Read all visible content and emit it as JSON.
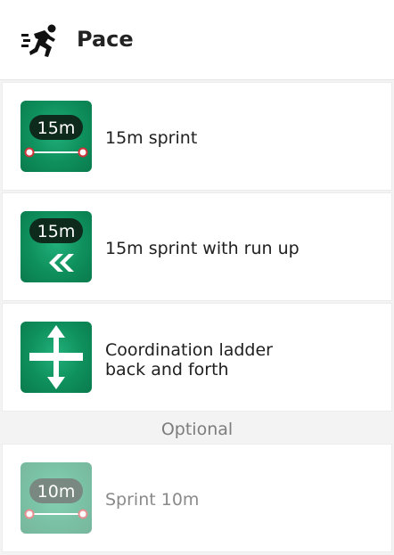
{
  "header": {
    "title": "Pace",
    "icon": "running-person-icon"
  },
  "exercises": [
    {
      "label": "15m sprint",
      "badge": "15m",
      "icon": "sprint-15m-icon"
    },
    {
      "label": "15m sprint with run up",
      "badge": "15m",
      "icon": "sprint-run-up-icon"
    },
    {
      "label_line1": "Coordination ladder",
      "label_line2": "back and forth",
      "icon": "coordination-ladder-icon"
    }
  ],
  "optional_section": {
    "title": "Optional",
    "items": [
      {
        "label": "Sprint 10m",
        "badge": "10m",
        "icon": "sprint-10m-icon"
      }
    ]
  }
}
